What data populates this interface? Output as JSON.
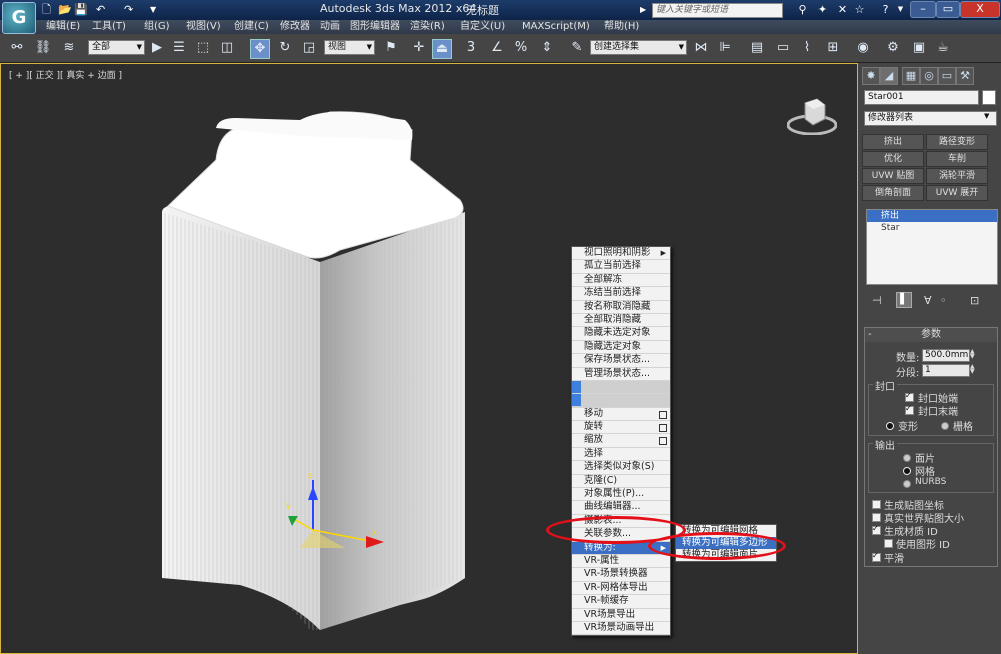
{
  "titlebar": {
    "app_logo": "G",
    "app_title": "Autodesk 3ds Max  2012 x64",
    "doc_title": "无标题",
    "search_placeholder": "键入关键字或短语",
    "win_min": "–",
    "win_max": "▭",
    "win_close": "X"
  },
  "menus": [
    "编辑(E)",
    "工具(T)",
    "组(G)",
    "视图(V)",
    "创建(C)",
    "修改器",
    "动画",
    "图形编辑器",
    "渲染(R)",
    "自定义(U)",
    "MAXScript(M)",
    "帮助(H)"
  ],
  "toolbar": {
    "selection_filter": "全部",
    "ref_coord": "视图",
    "named_selection": "创建选择集",
    "snap_3": "3",
    "snap_percent": "%"
  },
  "viewport": {
    "label": "[ + ][ 正交 ][ 真实 + 边面 ]"
  },
  "command_panel": {
    "object_name": "Star001",
    "modifier_list": "修改器列表",
    "modifier_buttons": [
      "挤出",
      "路径变形",
      "优化",
      "车削",
      "UVW 贴图",
      "涡轮平滑",
      "倒角剖面",
      "UVW 展开"
    ],
    "stack": [
      {
        "label": "挤出",
        "selected": true
      },
      {
        "label": "Star",
        "selected": false
      }
    ],
    "rollout_title": "参数",
    "amount_label": "数量:",
    "amount_value": "500.0mm",
    "segments_label": "分段:",
    "segments_value": "1",
    "capping_title": "封口",
    "cap_start": "封口始端",
    "cap_end": "封口末端",
    "morph": "变形",
    "grid": "栅格",
    "output_title": "输出",
    "out_patch": "面片",
    "out_mesh": "网格",
    "out_nurbs": "NURBS",
    "gen_map_coords": "生成贴图坐标",
    "real_world_map": "真实世界贴图大小",
    "gen_mat_ids": "生成材质 ID",
    "use_shape_ids": "使用图形 ID",
    "smooth": "平滑"
  },
  "quad_menu": {
    "items": [
      {
        "label": "视口照明和阴影",
        "arrow": true
      },
      {
        "label": "孤立当前选择"
      },
      {
        "label": "全部解冻"
      },
      {
        "label": "冻结当前选择"
      },
      {
        "label": "按名称取消隐藏"
      },
      {
        "label": "全部取消隐藏"
      },
      {
        "label": "隐藏未选定对象"
      },
      {
        "label": "隐藏选定对象"
      },
      {
        "label": "保存场景状态..."
      },
      {
        "label": "管理场景状态..."
      },
      {
        "label": "",
        "bar": true
      },
      {
        "label": "",
        "bar": true
      },
      {
        "label": "移动",
        "box": true
      },
      {
        "label": "旋转",
        "box": true
      },
      {
        "label": "缩放",
        "box": true
      },
      {
        "label": "选择"
      },
      {
        "label": "选择类似对象(S)"
      },
      {
        "label": "克隆(C)"
      },
      {
        "label": "对象属性(P)..."
      },
      {
        "label": "曲线编辑器..."
      },
      {
        "label": "摄影表..."
      },
      {
        "label": "关联参数..."
      },
      {
        "label": "转换为:",
        "arrow": true,
        "highlight": true
      },
      {
        "label": "VR-属性"
      },
      {
        "label": "VR-场景转换器"
      },
      {
        "label": "VR-网格体导出"
      },
      {
        "label": "VR-帧缓存"
      },
      {
        "label": "VR场景导出"
      },
      {
        "label": "VR场景动画导出"
      }
    ],
    "submenu": [
      {
        "label": "转换为可编辑网格"
      },
      {
        "label": "转换为可编辑多边形",
        "highlight": true
      },
      {
        "label": "转换为可编辑面片"
      }
    ]
  },
  "colors": {
    "highlight": "#3b6fc3",
    "annotation": "#e3101a",
    "viewport_border": "#d7b43c"
  }
}
